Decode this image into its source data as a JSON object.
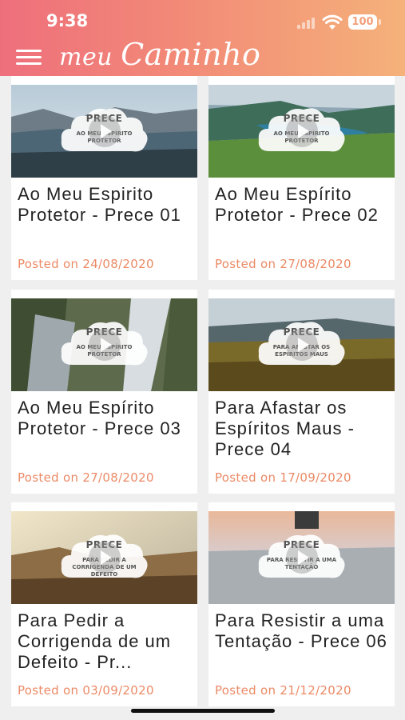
{
  "status_bar": {
    "time": "9:38",
    "battery": "100"
  },
  "header": {
    "title_prefix": "meu",
    "title_main": "Caminho"
  },
  "colors": {
    "header_start": "#ee6f7c",
    "header_end": "#f5b27a",
    "date": "#eb8a66"
  },
  "posts": [
    {
      "thumb_title": "PRECE",
      "thumb_subtitle": "AO MEU ESPÍRITO PROTETOR",
      "title": "Ao Meu Espirito Protetor - Prece 01",
      "date": "Posted on 24/08/2020"
    },
    {
      "thumb_title": "PRECE",
      "thumb_subtitle": "AO MEU ESPÍRITO PROTETOR",
      "title": "Ao Meu Espírito Protetor - Prece 02",
      "date": "Posted on 27/08/2020"
    },
    {
      "thumb_title": "PRECE",
      "thumb_subtitle": "AO MEU ESPÍRITO PROTETOR",
      "title": "Ao Meu Espírito Protetor - Prece 03",
      "date": "Posted on 27/08/2020"
    },
    {
      "thumb_title": "PRECE",
      "thumb_subtitle": "PARA AFASTAR OS ESPÍRITOS MAUS",
      "title": "Para Afastar os Espíritos Maus - Prece 04",
      "date": "Posted on 17/09/2020"
    },
    {
      "thumb_title": "PRECE",
      "thumb_subtitle": "PARA PEDIR A CORRIGENDA DE UM DEFEITO",
      "title": "Para Pedir a Corrigenda de um Defeito - Pr...",
      "date": "Posted on 03/09/2020"
    },
    {
      "thumb_title": "PRECE",
      "thumb_subtitle": "PARA RESISTIR A UMA TENTAÇÃO",
      "title": "Para Resistir a uma Tentação - Prece 06",
      "date": "Posted on 21/12/2020"
    }
  ]
}
